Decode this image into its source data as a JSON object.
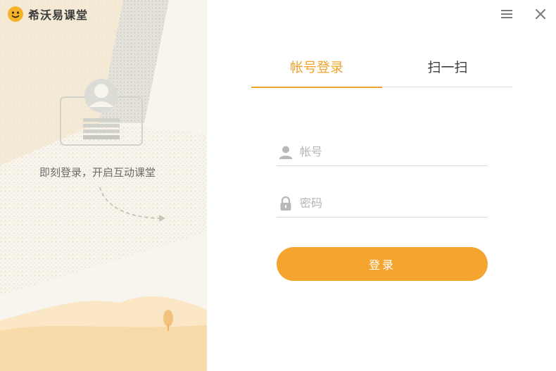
{
  "brand": {
    "name": "希沃易课堂",
    "logo_icon": "emoji-face-icon"
  },
  "illustration": {
    "slogan": "即刻登录，开启互动课堂"
  },
  "window": {
    "menu_icon": "menu-icon",
    "close_icon": "close-icon"
  },
  "tabs": [
    {
      "label": "帐号登录",
      "active": true
    },
    {
      "label": "扫一扫",
      "active": false
    }
  ],
  "form": {
    "account": {
      "placeholder": "帐号",
      "value": "",
      "icon": "user-icon"
    },
    "password": {
      "placeholder": "密码",
      "value": "",
      "icon": "lock-icon"
    },
    "submit_label": "登录"
  },
  "colors": {
    "accent": "#f5a430",
    "tab_active": "#efa42e",
    "left_bg": "#f7f3ea"
  }
}
